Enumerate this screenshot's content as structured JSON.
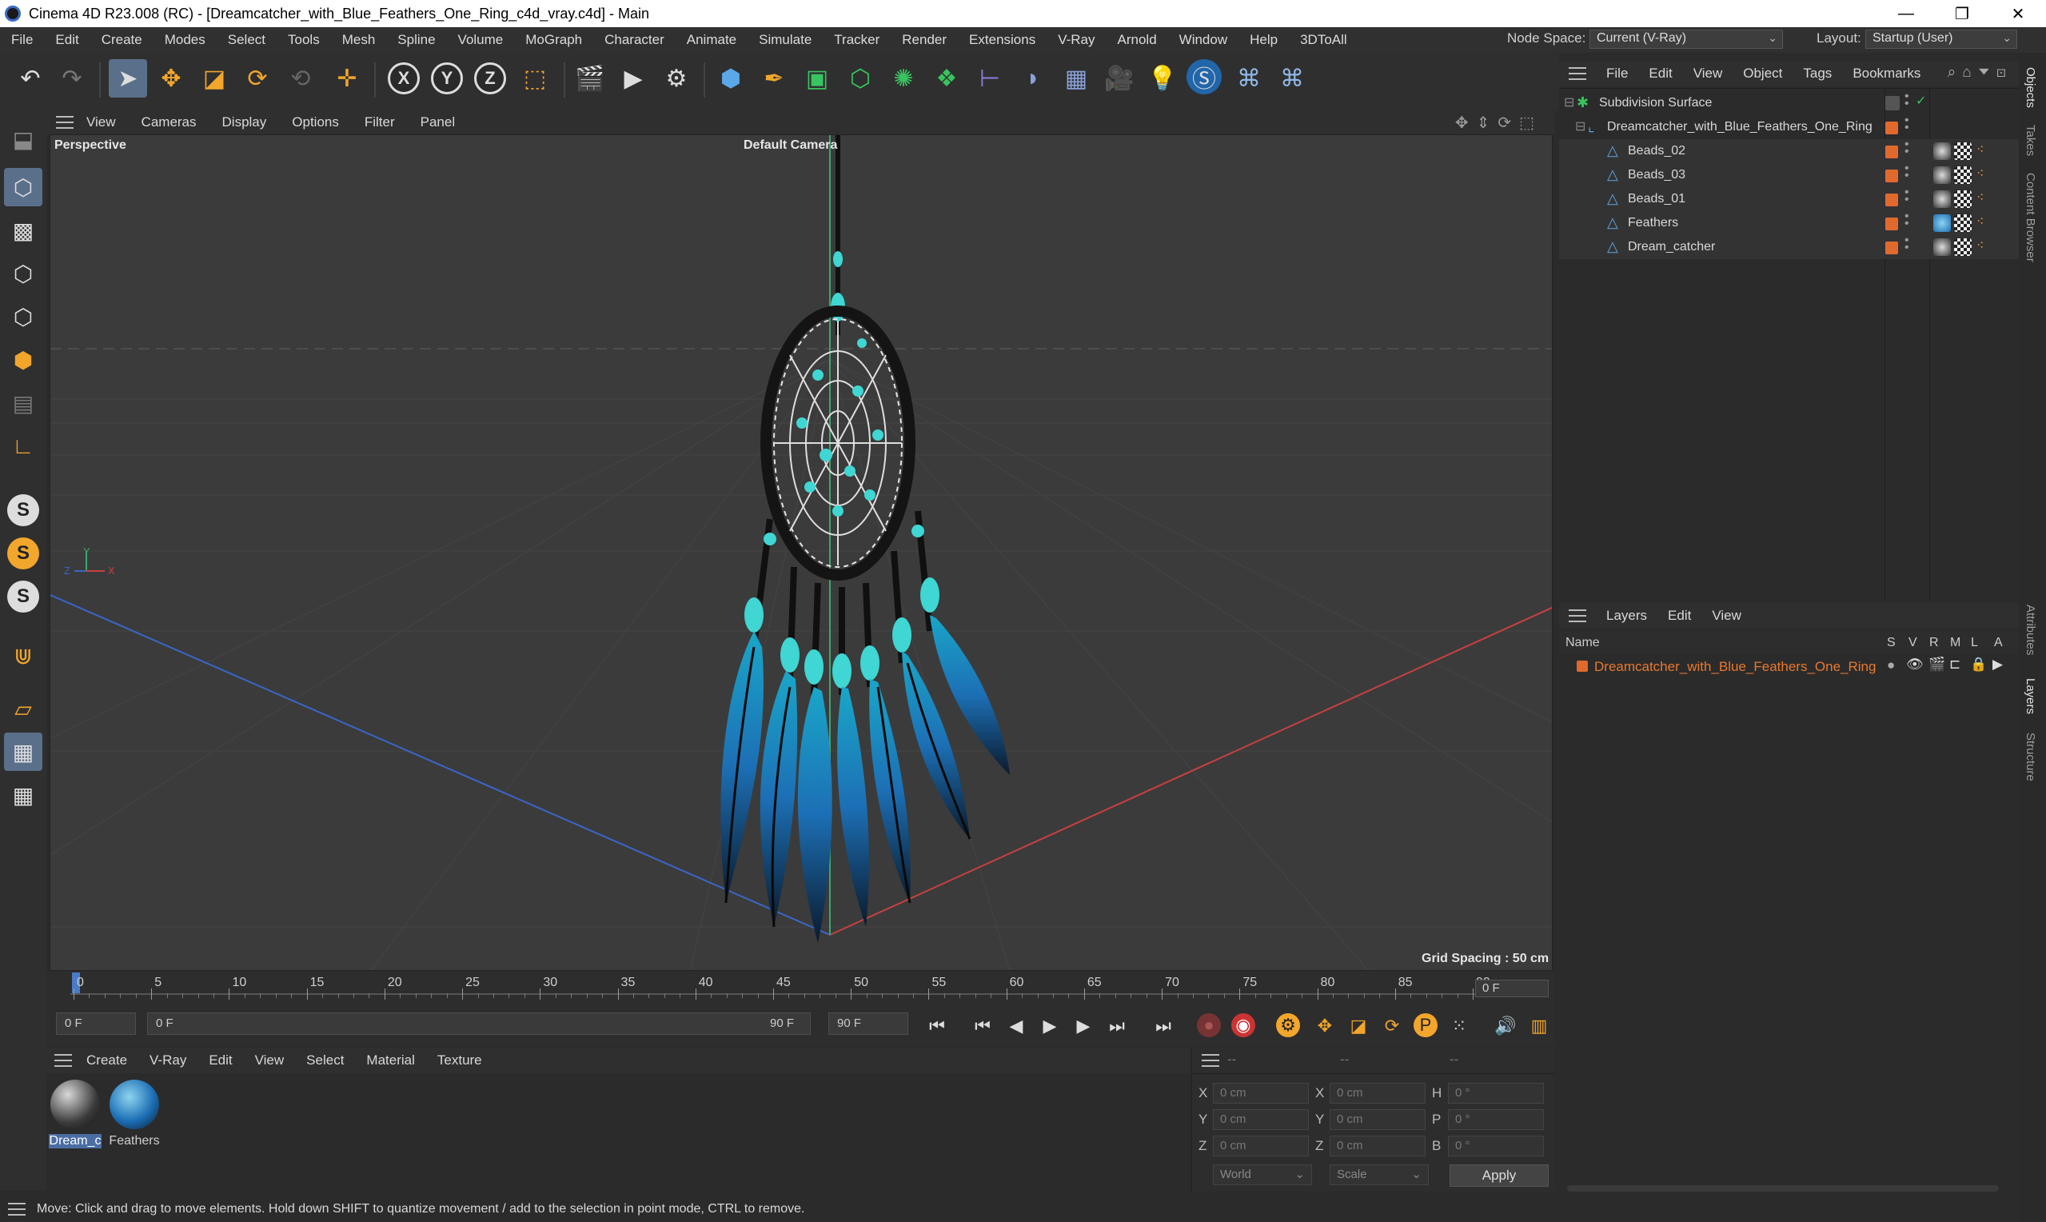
{
  "window": {
    "title": "Cinema 4D R23.008 (RC) - [Dreamcatcher_with_Blue_Feathers_One_Ring_c4d_vray.c4d] - Main",
    "buttons": [
      "—",
      "❐",
      "✕"
    ]
  },
  "menubar": {
    "items": [
      "File",
      "Edit",
      "Create",
      "Modes",
      "Select",
      "Tools",
      "Mesh",
      "Spline",
      "Volume",
      "MoGraph",
      "Character",
      "Animate",
      "Simulate",
      "Tracker",
      "Render",
      "Extensions",
      "V-Ray",
      "Arnold",
      "Window",
      "Help",
      "3DToAll"
    ],
    "node_space_label": "Node Space:",
    "node_space_value": "Current (V-Ray)",
    "layout_label": "Layout:",
    "layout_value": "Startup (User)"
  },
  "toolbar": {
    "icons": [
      "undo-icon",
      "redo-icon",
      "select-icon",
      "move-icon",
      "scale-icon",
      "rotate-icon",
      "recent-tool-icon",
      "transform-icon",
      "x-axis-icon",
      "y-axis-icon",
      "z-axis-icon",
      "coordinate-system-icon",
      "render-region-icon",
      "render-view-icon",
      "render-settings-icon",
      "cube-icon",
      "pen-icon",
      "subdivision-icon",
      "extrude-icon",
      "cloner-icon",
      "mograph-icon",
      "symmetry-icon",
      "deformer-icon",
      "floor-icon",
      "camera-icon",
      "light-icon",
      "vray-icon",
      "python-icon",
      "python2-icon"
    ],
    "axis_labels": [
      "X",
      "Y",
      "Z"
    ]
  },
  "left_tools": {
    "icons": [
      "make-editable-icon",
      "model-mode-icon",
      "texture-mode-icon",
      "points-mode-icon",
      "edges-mode-icon",
      "polygons-mode-icon",
      "uv-mode-icon",
      "axis-mode-icon",
      "snap-icon",
      "snap-settings-icon",
      "snap-extra-icon",
      "magnet-icon",
      "workplane-icon",
      "lock-workplane-icon",
      "grid-snap-icon"
    ],
    "snap_letters": [
      "S",
      "S",
      "S"
    ]
  },
  "viewport": {
    "menu": [
      "View",
      "Cameras",
      "Display",
      "Options",
      "Filter",
      "Panel"
    ],
    "projection": "Perspective",
    "camera": "Default Camera",
    "grid_spacing": "Grid Spacing : 50 cm",
    "axis_labels": {
      "x": "X",
      "y": "Y",
      "z": "Z"
    }
  },
  "timeline": {
    "ticks": [
      "0",
      "5",
      "10",
      "15",
      "20",
      "25",
      "30",
      "35",
      "40",
      "45",
      "50",
      "55",
      "60",
      "65",
      "70",
      "75",
      "80",
      "85",
      "90"
    ],
    "current_frame": "0 F"
  },
  "transport": {
    "start_field": "0 F",
    "range_start": "0 F",
    "range_end": "90 F",
    "end_field": "90 F"
  },
  "material_manager": {
    "menu": [
      "Create",
      "V-Ray",
      "Edit",
      "View",
      "Select",
      "Material",
      "Texture"
    ],
    "materials": [
      {
        "name": "Dream_c",
        "selected": true
      },
      {
        "name": "Feathers",
        "selected": false
      }
    ]
  },
  "coordinates": {
    "header_left": "--",
    "header_mid": "--",
    "header_right": "--",
    "rows": [
      {
        "l1": "X",
        "v1": "0 cm",
        "l2": "X",
        "v2": "0 cm",
        "l3": "H",
        "v3": "0 °"
      },
      {
        "l1": "Y",
        "v1": "0 cm",
        "l2": "Y",
        "v2": "0 cm",
        "l3": "P",
        "v3": "0 °"
      },
      {
        "l1": "Z",
        "v1": "0 cm",
        "l2": "Z",
        "v2": "0 cm",
        "l3": "B",
        "v3": "0 °"
      }
    ],
    "mode": "World",
    "scale": "Scale",
    "apply": "Apply"
  },
  "status": {
    "text": "Move: Click and drag to move elements. Hold down SHIFT to quantize movement / add to the selection in point mode, CTRL to remove."
  },
  "object_manager": {
    "menu": [
      "File",
      "Edit",
      "View",
      "Object",
      "Tags",
      "Bookmarks"
    ],
    "objects": [
      {
        "name": "Subdivision Surface",
        "level": 0
      },
      {
        "name": "Dreamcatcher_with_Blue_Feathers_One_Ring",
        "level": 1
      },
      {
        "name": "Beads_02",
        "level": 2
      },
      {
        "name": "Beads_03",
        "level": 2
      },
      {
        "name": "Beads_01",
        "level": 2
      },
      {
        "name": "Feathers",
        "level": 2
      },
      {
        "name": "Dream_catcher",
        "level": 2
      }
    ]
  },
  "layer_manager": {
    "menu": [
      "Layers",
      "Edit",
      "View"
    ],
    "columns": [
      "Name",
      "S",
      "V",
      "R",
      "M",
      "L",
      "A"
    ],
    "layers": [
      {
        "name": "Dreamcatcher_with_Blue_Feathers_One_Ring",
        "color": "#e06a2e"
      }
    ]
  },
  "side_tabs": [
    "Objects",
    "Takes",
    "Content Browser",
    "Attributes",
    "Layers",
    "Structure"
  ],
  "colors": {
    "accent": "#5a6f8a",
    "selection": "#4a6ea3",
    "layer_color": "#e06a2e",
    "layer_text": "#e8792f",
    "turquoise": "#3fd6d3",
    "feather_blue": "#1c6fb5"
  }
}
